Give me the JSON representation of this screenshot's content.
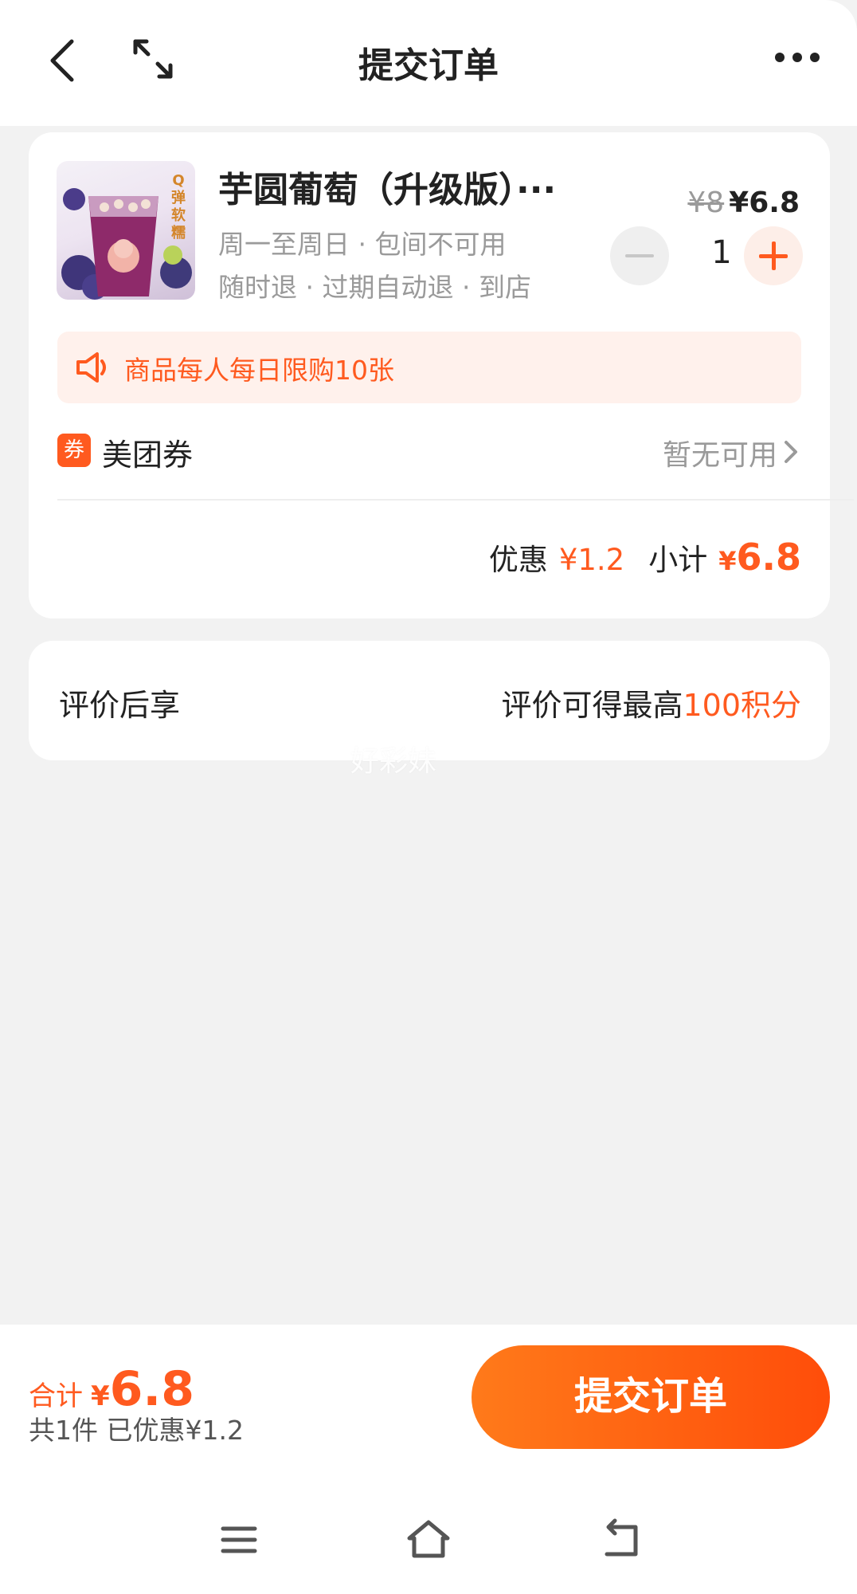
{
  "header": {
    "title": "提交订单"
  },
  "product": {
    "name": "芋圆葡萄（升级版）···",
    "usage_days": "周一至周日 · 包间不可用",
    "refund_terms": "随时退 · 过期自动退 · 到店",
    "original_price": "¥8",
    "price": "¥6.8",
    "quantity": "1",
    "image_text": "Q弹软糯"
  },
  "notice": {
    "limit_text": "商品每人每日限购10张"
  },
  "coupon": {
    "badge": "券",
    "label": "美团券",
    "value": "暂无可用"
  },
  "summary": {
    "discount_label": "优惠",
    "discount_value": "¥1.2",
    "subtotal_label": "小计",
    "subtotal_currency": "¥",
    "subtotal_value": "6.8"
  },
  "review": {
    "label": "评价后享",
    "value_prefix": "评价可得最高",
    "value_highlight": "100积分"
  },
  "watermark": "好彩妹",
  "footer": {
    "total_label": "合计",
    "total_currency": "¥",
    "total_value": "6.8",
    "count_text": "共1件  已优惠¥1.2",
    "submit_label": "提交订单"
  },
  "colors": {
    "accent": "#ff5a1f",
    "background": "#f2f2f2"
  }
}
